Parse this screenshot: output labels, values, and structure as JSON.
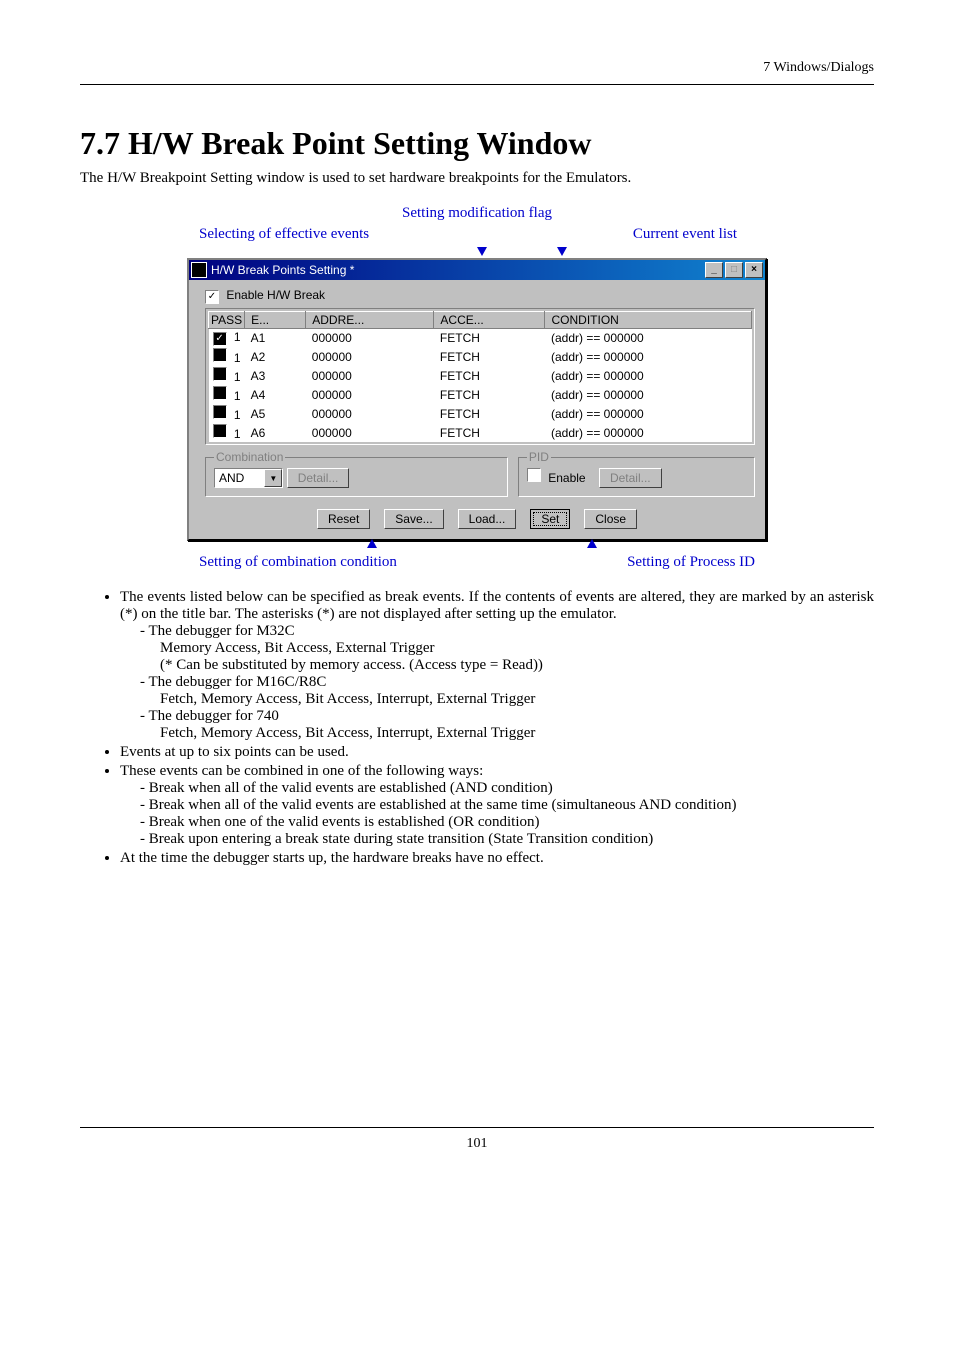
{
  "page": {
    "header_right": "7  Windows/Dialogs",
    "section_title": "7.7 H/W Break Point Setting Window",
    "lead": "The H/W Breakpoint Setting window is used to set hardware breakpoints for the Emulators.",
    "page_number": "101"
  },
  "annotations": {
    "top_center": "Setting modification flag",
    "left": "Selecting of effective events",
    "right": "Current event list",
    "bottom_left": "Setting of combination condition",
    "bottom_right": "Setting of Process ID"
  },
  "window": {
    "title": "H/W Break Points Setting *",
    "enable_label": "Enable H/W Break",
    "enable_checked": true,
    "columns": {
      "c0": "PASS",
      "c1": "E...",
      "c2": "ADDRE...",
      "c3": "ACCE...",
      "c4": "CONDITION"
    },
    "rows": [
      {
        "chk": true,
        "pass": "1",
        "e": "A1",
        "addr": "000000",
        "acc": "FETCH",
        "cond": "(addr) == 000000"
      },
      {
        "chk": false,
        "pass": "1",
        "e": "A2",
        "addr": "000000",
        "acc": "FETCH",
        "cond": "(addr) == 000000"
      },
      {
        "chk": false,
        "pass": "1",
        "e": "A3",
        "addr": "000000",
        "acc": "FETCH",
        "cond": "(addr) == 000000"
      },
      {
        "chk": false,
        "pass": "1",
        "e": "A4",
        "addr": "000000",
        "acc": "FETCH",
        "cond": "(addr) == 000000"
      },
      {
        "chk": false,
        "pass": "1",
        "e": "A5",
        "addr": "000000",
        "acc": "FETCH",
        "cond": "(addr) == 000000"
      },
      {
        "chk": false,
        "pass": "1",
        "e": "A6",
        "addr": "000000",
        "acc": "FETCH",
        "cond": "(addr) == 000000"
      }
    ],
    "combination": {
      "title": "Combination",
      "value": "AND",
      "detail": "Detail..."
    },
    "pid": {
      "title": "PID",
      "enable_label": "Enable",
      "enable_checked": false,
      "detail": "Detail..."
    },
    "buttons": {
      "reset": "Reset",
      "save": "Save...",
      "load": "Load...",
      "set": "Set",
      "close": "Close"
    },
    "controls": {
      "minimize": "_",
      "maximize": "□",
      "close": "×"
    }
  },
  "body": {
    "b1": "The events listed below can be specified as break events. If the contents of events are altered, they are marked by an asterisk (*) on the title bar. The asterisks (*) are not displayed after setting up the emulator.",
    "b1a": "-  The debugger for M32C",
    "b1a1": "Memory Access, Bit Access, External Trigger",
    "b1a2": "(* Can be substituted by memory access. (Access type = Read))",
    "b1b": "-  The debugger for M16C/R8C",
    "b1b1": "Fetch, Memory Access, Bit Access, Interrupt, External Trigger",
    "b1c": "-  The debugger for 740",
    "b1c1": "Fetch, Memory Access, Bit Access, Interrupt, External Trigger",
    "b2": "Events at up to six points can be used.",
    "b3": "These events can be combined in one of the following ways:",
    "b3a": "-  Break when all of the valid events are established (AND condition)",
    "b3b": "-  Break when all of the valid events are established at the same time (simultaneous AND condition)",
    "b3c": "-  Break when one of the valid events is established (OR condition)",
    "b3d": "-  Break upon entering a break state during state transition (State Transition condition)",
    "b4": "At the time the debugger starts up, the hardware breaks have no effect."
  }
}
